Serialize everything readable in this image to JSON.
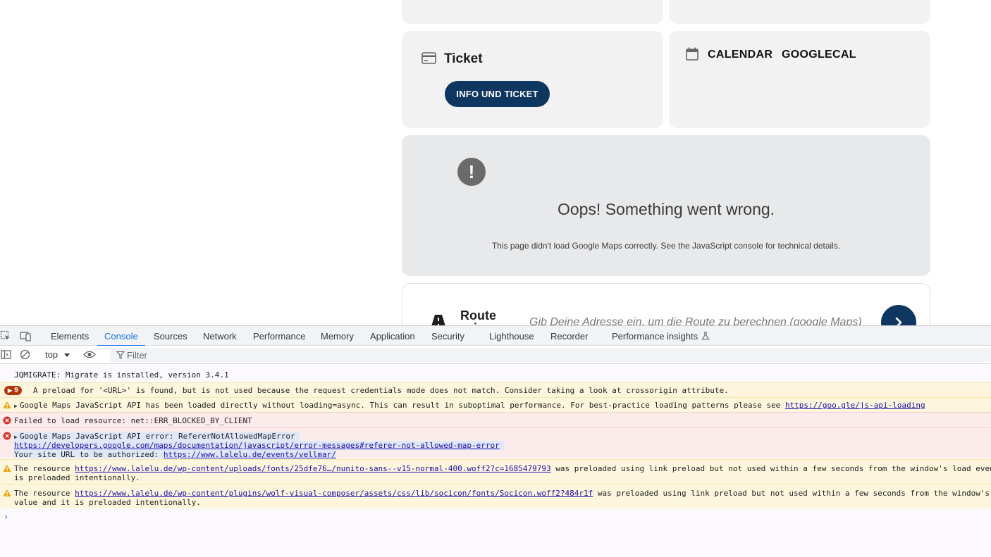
{
  "page": {
    "ticket": {
      "title": "Ticket",
      "button_label": "INFO UND TICKET"
    },
    "calendar": {
      "link1": "CALENDAR",
      "link2": "GOOGLECAL"
    },
    "map_error": {
      "icon": "!",
      "title": "Oops! Something went wrong.",
      "detail": "This page didn't load Google Maps correctly. See the JavaScript console for technical details."
    },
    "route": {
      "title": "Route zeigen",
      "placeholder": "Gib Deine Adresse ein, um die Route zu berechnen (google Maps)"
    }
  },
  "devtools": {
    "tabs": [
      "Elements",
      "Console",
      "Sources",
      "Network",
      "Performance",
      "Memory",
      "Application",
      "Security",
      "Lighthouse",
      "Recorder",
      "Performance insights"
    ],
    "active_tab": "Console",
    "toolbar": {
      "context": "top",
      "filter_placeholder": "Filter"
    },
    "messages": [
      {
        "level": "info",
        "text": "JQMIGRATE: Migrate is installed, version 3.4.1"
      },
      {
        "level": "warning",
        "count": "9",
        "text": "A preload for '<URL>' is found, but is not used because the request credentials mode does not match. Consider taking a look at crossorigin attribute."
      },
      {
        "level": "warning",
        "text": "Google Maps JavaScript API has been loaded directly without loading=async. This can result in suboptimal performance. For best-practice loading patterns please see ",
        "link": "https://goo.gle/js-api-loading"
      },
      {
        "level": "error",
        "text": "Failed to load resource: net::ERR_BLOCKED_BY_CLIENT"
      },
      {
        "level": "error",
        "text": "Google Maps JavaScript API error: RefererNotAllowedMapError",
        "link": "https://developers.google.com/maps/documentation/javascript/error-messages#referer-not-allowed-map-error",
        "line3_prefix": "Your site URL to be authorized: ",
        "line3_link": "https://www.lalelu.de/events/vellmar/"
      },
      {
        "level": "warning",
        "prefix": "The resource ",
        "link": "https://www.lalelu.de/wp-content/uploads/fonts/25dfe76…/nunito-sans--v15-normal-400.woff2?c=1685479793",
        "suffix": " was preloaded using link preload but not used within a few seconds from the window's load event. Please make sure it has an appropriate `as` value and it",
        "line2": "is preloaded intentionally."
      },
      {
        "level": "warning",
        "prefix": "The resource ",
        "link": "https://www.lalelu.de/wp-content/plugins/wolf-visual-composer/assets/css/lib/socicon/fonts/Socicon.woff2?484r1f",
        "suffix": " was preloaded using link preload but not used within a few seconds from the window's load event. Please make sure it has an appropriate `as`",
        "line2": "value and it is preloaded intentionally."
      }
    ],
    "prompt": "›"
  }
}
